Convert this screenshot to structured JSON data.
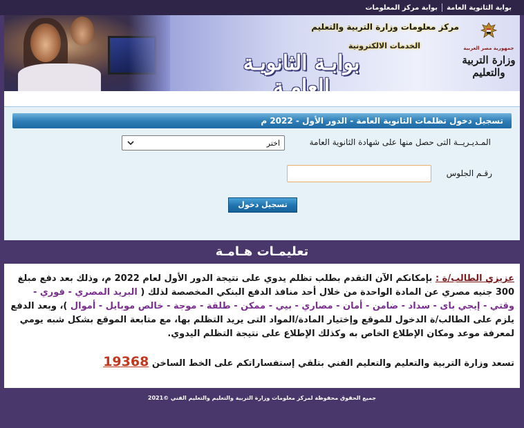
{
  "topnav": {
    "items": [
      "بوابة الثانوية العامة",
      "بوابة مركز المعلومات"
    ]
  },
  "banner": {
    "title_main": "بوابـة الثانويـة العامـة",
    "title_sub1": "مركز معلومات وزارة التربية والتعليم",
    "title_sub2": "الخدمات الالكترونية",
    "logo_gov": "جمهورية مصر العربية",
    "logo_ministry": "وزارة التربية والتعليم"
  },
  "login_panel": {
    "header": "تسجيل دخول تظلمات الثانوية العامة - الدور الأول - 2022 م",
    "directorate_label": "المـديـريــة التى حصل منها على شهادة الثانوية العامة",
    "directorate_select_value": "اختر",
    "seat_label": "رقـم الجلوس",
    "seat_value": "",
    "submit_label": "تسجيل دخول"
  },
  "instructions": {
    "header": "تعليمـات هـامـة",
    "student_label": "عزيزي الطالب/ة :",
    "para1_a": " بإمكانكم الآن التقدم بطلب تظلم يدوي على نتيجة الدور الأول لعام 2022 م، وذلك بعد دفع مبلغ 300 جنيه مصري عن المادة الواحدة من خلال أحد منافذ الدفع البنكي المخصصة لذلك (",
    "payment_methods": " البريد المصري - فوري - وقتي - إيجي باى - سداد - ضامن - أمان - مصاري - بيي - ممكن - طلقة - موجة - خالص موبايل - أموال ",
    "para1_b": ")، وبعد الدفع يلزم على الطالب/ة الدخول للموقع وإختيار المادة/المواد التى يريد التظلم بها، مع متابعة الموقع بشكل شبه يومي لمعرفة موعد ومكان الإطلاع الخاص به وكذلك الإطلاع على نتيجة التظلم اليدوي.",
    "para2": "تسعد وزارة التربية والتعليم والتعليم الفني بتلقي إستفساراتكم على الخط الساخن ",
    "hotline": "19368"
  },
  "footer": {
    "text": "جميع الحقوق محفوظة لمركز معلومات وزارة التربية والتعليم والتعليم الفني ©2021"
  },
  "colors": {
    "page_bg": "#49376c",
    "panel_bg": "#e6f1f8",
    "header_blue": "#1f6aa2",
    "student_red": "#7a1c1c",
    "payment_purple": "#7a2f8f",
    "hotline_red": "#c0391f"
  }
}
